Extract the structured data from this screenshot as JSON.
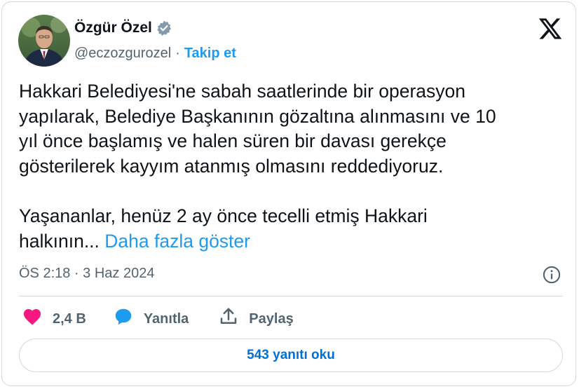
{
  "author": {
    "name": "Özgür Özel",
    "handle": "@eczozgurozel",
    "separator": "·",
    "follow_label": "Takip et",
    "verified": true
  },
  "tweet": {
    "text": "Hakkari Belediyesi'ne sabah saatlerinde bir operasyon\nyapılarak, Belediye Başkanının gözaltına alınmasını ve 10\nyıl önce başlamış ve halen süren bir davası gerekçe\ngösterilerek kayyım atanmış olmasını reddediyoruz.\n\nYaşananlar, henüz 2 ay önce tecelli etmiş Hakkari\nhalkının...",
    "show_more_label": "Daha fazla göster",
    "timestamp": "ÖS 2:18 · 3 Haz 2024"
  },
  "actions": {
    "likes_count": "2,4 B",
    "reply_label": "Yanıtla",
    "share_label": "Paylaş"
  },
  "read_replies_label": "543 yanıtı oku",
  "icons": {
    "brand": "x-logo-icon",
    "verified": "verified-badge-icon",
    "info": "info-icon",
    "like": "heart-icon",
    "reply": "speech-bubble-icon",
    "share": "share-upload-icon"
  },
  "colors": {
    "accent": "#1d9bf0",
    "like": "#f91880",
    "text": "#0f1419",
    "muted": "#536471",
    "border": "#cfd9de",
    "verified_badge": "#829aab"
  }
}
